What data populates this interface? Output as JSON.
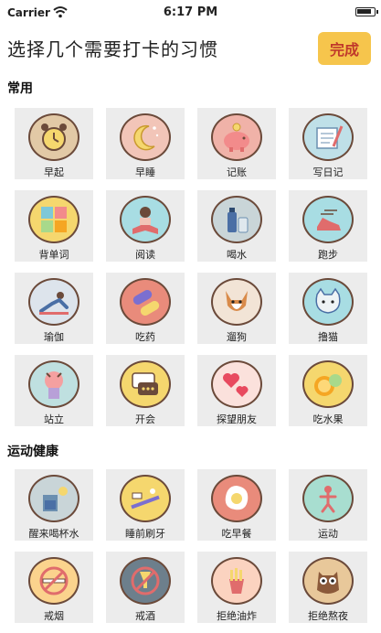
{
  "status": {
    "carrier": "Carrier",
    "time": "6:17 PM"
  },
  "header": {
    "title": "选择几个需要打卡的习惯",
    "done_label": "完成"
  },
  "sections": [
    {
      "title": "常用",
      "items": [
        {
          "label": "早起",
          "icon": "alarm-clock-icon",
          "bg": "#e2c9a6"
        },
        {
          "label": "早睡",
          "icon": "moon-icon",
          "bg": "#f2c5b8"
        },
        {
          "label": "记账",
          "icon": "piggy-bank-icon",
          "bg": "#f0b2a8"
        },
        {
          "label": "写日记",
          "icon": "notebook-pen-icon",
          "bg": "#bfe0e8"
        },
        {
          "label": "背单词",
          "icon": "flashcards-icon",
          "bg": "#f5d76e"
        },
        {
          "label": "阅读",
          "icon": "reading-icon",
          "bg": "#a8dde3"
        },
        {
          "label": "喝水",
          "icon": "water-bottle-icon",
          "bg": "#c9d5d8"
        },
        {
          "label": "跑步",
          "icon": "running-shoe-icon",
          "bg": "#a8dde3"
        },
        {
          "label": "瑜伽",
          "icon": "yoga-icon",
          "bg": "#dde4ec"
        },
        {
          "label": "吃药",
          "icon": "pills-icon",
          "bg": "#e98b7b"
        },
        {
          "label": "遛狗",
          "icon": "dog-icon",
          "bg": "#f2e4d6"
        },
        {
          "label": "撸猫",
          "icon": "cat-icon",
          "bg": "#a8dde3"
        },
        {
          "label": "站立",
          "icon": "standing-icon",
          "bg": "#bfe0e0"
        },
        {
          "label": "开会",
          "icon": "meeting-icon",
          "bg": "#f5d76e"
        },
        {
          "label": "探望朋友",
          "icon": "hearts-icon",
          "bg": "#fbe1dc"
        },
        {
          "label": "吃水果",
          "icon": "fruit-icon",
          "bg": "#f5d76e"
        }
      ]
    },
    {
      "title": "运动健康",
      "items": [
        {
          "label": "醒来喝杯水",
          "icon": "water-glass-icon",
          "bg": "#c9d5d8"
        },
        {
          "label": "睡前刷牙",
          "icon": "toothbrush-icon",
          "bg": "#f5d76e"
        },
        {
          "label": "吃早餐",
          "icon": "fried-egg-icon",
          "bg": "#e98b7b"
        },
        {
          "label": "运动",
          "icon": "exercise-icon",
          "bg": "#a8ded0"
        },
        {
          "label": "戒烟",
          "icon": "no-smoking-icon",
          "bg": "#fbd38d"
        },
        {
          "label": "戒酒",
          "icon": "no-alcohol-icon",
          "bg": "#6d7f8c"
        },
        {
          "label": "拒绝油炸",
          "icon": "no-fries-icon",
          "bg": "#fbd3c0"
        },
        {
          "label": "拒绝熬夜",
          "icon": "owl-icon",
          "bg": "#e8c89a"
        }
      ]
    }
  ]
}
